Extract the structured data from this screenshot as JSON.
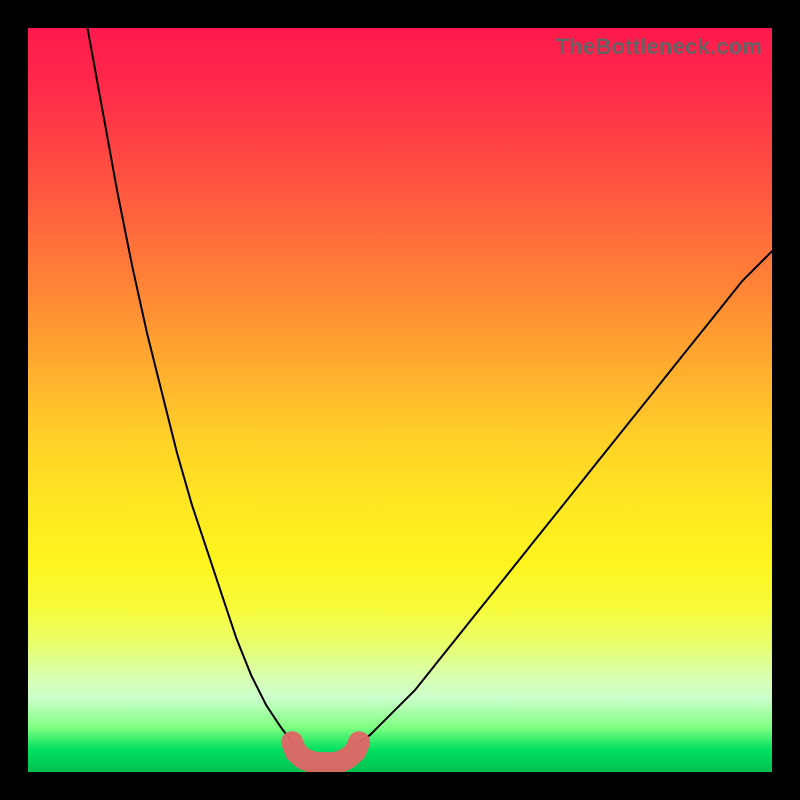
{
  "watermark": "TheBottleneck.com",
  "colors": {
    "curve": "#000000",
    "marker": "#e06666",
    "gradient_top": "#ff1a4d",
    "gradient_bottom": "#00c050"
  },
  "chart_data": {
    "type": "line",
    "title": "",
    "xlabel": "",
    "ylabel": "",
    "xlim": [
      0,
      100
    ],
    "ylim": [
      0,
      100
    ],
    "grid": false,
    "series": [
      {
        "name": "left-curve",
        "x": [
          8,
          10,
          12,
          14,
          16,
          18,
          20,
          22,
          24,
          26,
          28,
          30,
          32,
          34,
          35.5
        ],
        "y": [
          100,
          89,
          78,
          68,
          59,
          51,
          43,
          36,
          30,
          24,
          18,
          13,
          9,
          6,
          4
        ]
      },
      {
        "name": "right-curve",
        "x": [
          44.5,
          46,
          48,
          52,
          56,
          60,
          64,
          68,
          72,
          76,
          80,
          84,
          88,
          92,
          96,
          100
        ],
        "y": [
          4,
          5,
          7,
          11,
          16,
          21,
          26,
          31,
          36,
          41,
          46,
          51,
          56,
          61,
          66,
          70
        ]
      },
      {
        "name": "target-marker",
        "x": [
          35.5,
          36,
          37,
          38,
          39,
          40,
          41,
          42,
          43,
          44,
          44.5
        ],
        "y": [
          4,
          2.7,
          1.8,
          1.4,
          1.2,
          1.2,
          1.2,
          1.4,
          1.9,
          2.8,
          4
        ]
      }
    ],
    "annotations": [
      {
        "text": "TheBottleneck.com",
        "position": "top-right"
      }
    ]
  }
}
